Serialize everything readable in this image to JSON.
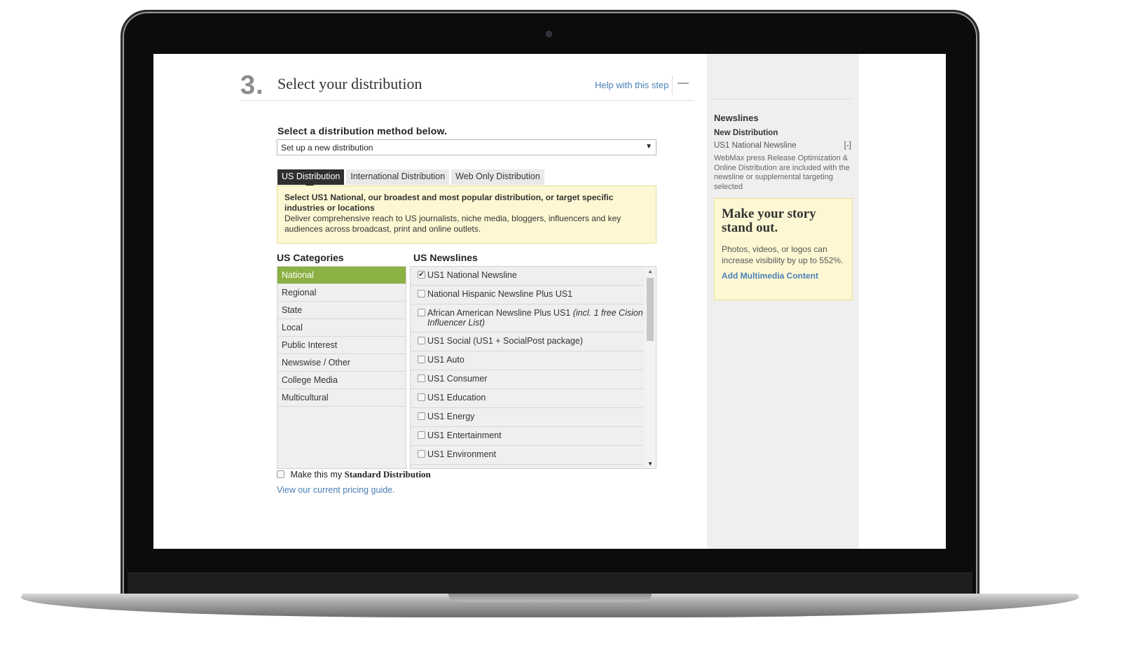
{
  "step": {
    "number": "3.",
    "title": "Select your distribution",
    "help_link": "Help with this step",
    "collapse_icon": "—"
  },
  "method": {
    "label": "Select a distribution method below.",
    "selected": "Set up a new distribution",
    "caret": "▼"
  },
  "tabs": [
    {
      "label": "US Distribution",
      "active": true
    },
    {
      "label": "International Distribution",
      "active": false
    },
    {
      "label": "Web Only Distribution",
      "active": false
    }
  ],
  "info": {
    "headline": "Select US1 National, our broadest and most popular distribution, or target specific industries or locations",
    "body": "Deliver comprehensive reach to US journalists, niche media, bloggers, influencers and key audiences across broadcast, print and online outlets."
  },
  "categories": {
    "title": "US Categories",
    "items": [
      "National",
      "Regional",
      "State",
      "Local",
      "Public Interest",
      "Newswise / Other",
      "College Media",
      "Multicultural"
    ],
    "active": "National"
  },
  "newslines": {
    "title": "US Newslines",
    "items": [
      {
        "label": "US1 National Newsline",
        "checked": true,
        "note": ""
      },
      {
        "label": "National Hispanic Newsline Plus US1",
        "checked": false,
        "note": ""
      },
      {
        "label": "African American Newsline Plus US1 ",
        "checked": false,
        "note": "(incl. 1 free Cision Influencer List)"
      },
      {
        "label": "US1 Social (US1 + SocialPost package)",
        "checked": false,
        "note": ""
      },
      {
        "label": "US1 Auto",
        "checked": false,
        "note": ""
      },
      {
        "label": "US1 Consumer",
        "checked": false,
        "note": ""
      },
      {
        "label": "US1 Education",
        "checked": false,
        "note": ""
      },
      {
        "label": "US1 Energy",
        "checked": false,
        "note": ""
      },
      {
        "label": "US1 Entertainment",
        "checked": false,
        "note": ""
      },
      {
        "label": "US1 Environment",
        "checked": false,
        "note": ""
      }
    ],
    "check_mark": "✔"
  },
  "standard": {
    "prefix": "Make this my",
    "bold": "Standard Distribution"
  },
  "pricing_link": "View our current pricing guide.",
  "sidebar": {
    "heading": "Newslines",
    "sub": "New Distribution",
    "item": "US1 National Newsline",
    "toggle": "[-]",
    "desc": "WebMax press Release Optimization & Online Distribution are included with the newsline or supplemental targeting selected",
    "promo_title": "Make your story stand out.",
    "promo_text": "Photos, videos, or logos can increase visibility by up to 552%.",
    "promo_link": "Add Multimedia Content"
  },
  "colors": {
    "accent_green": "#8bb043",
    "link_blue": "#4a7fb5",
    "info_yellow": "#fdf8d3"
  }
}
